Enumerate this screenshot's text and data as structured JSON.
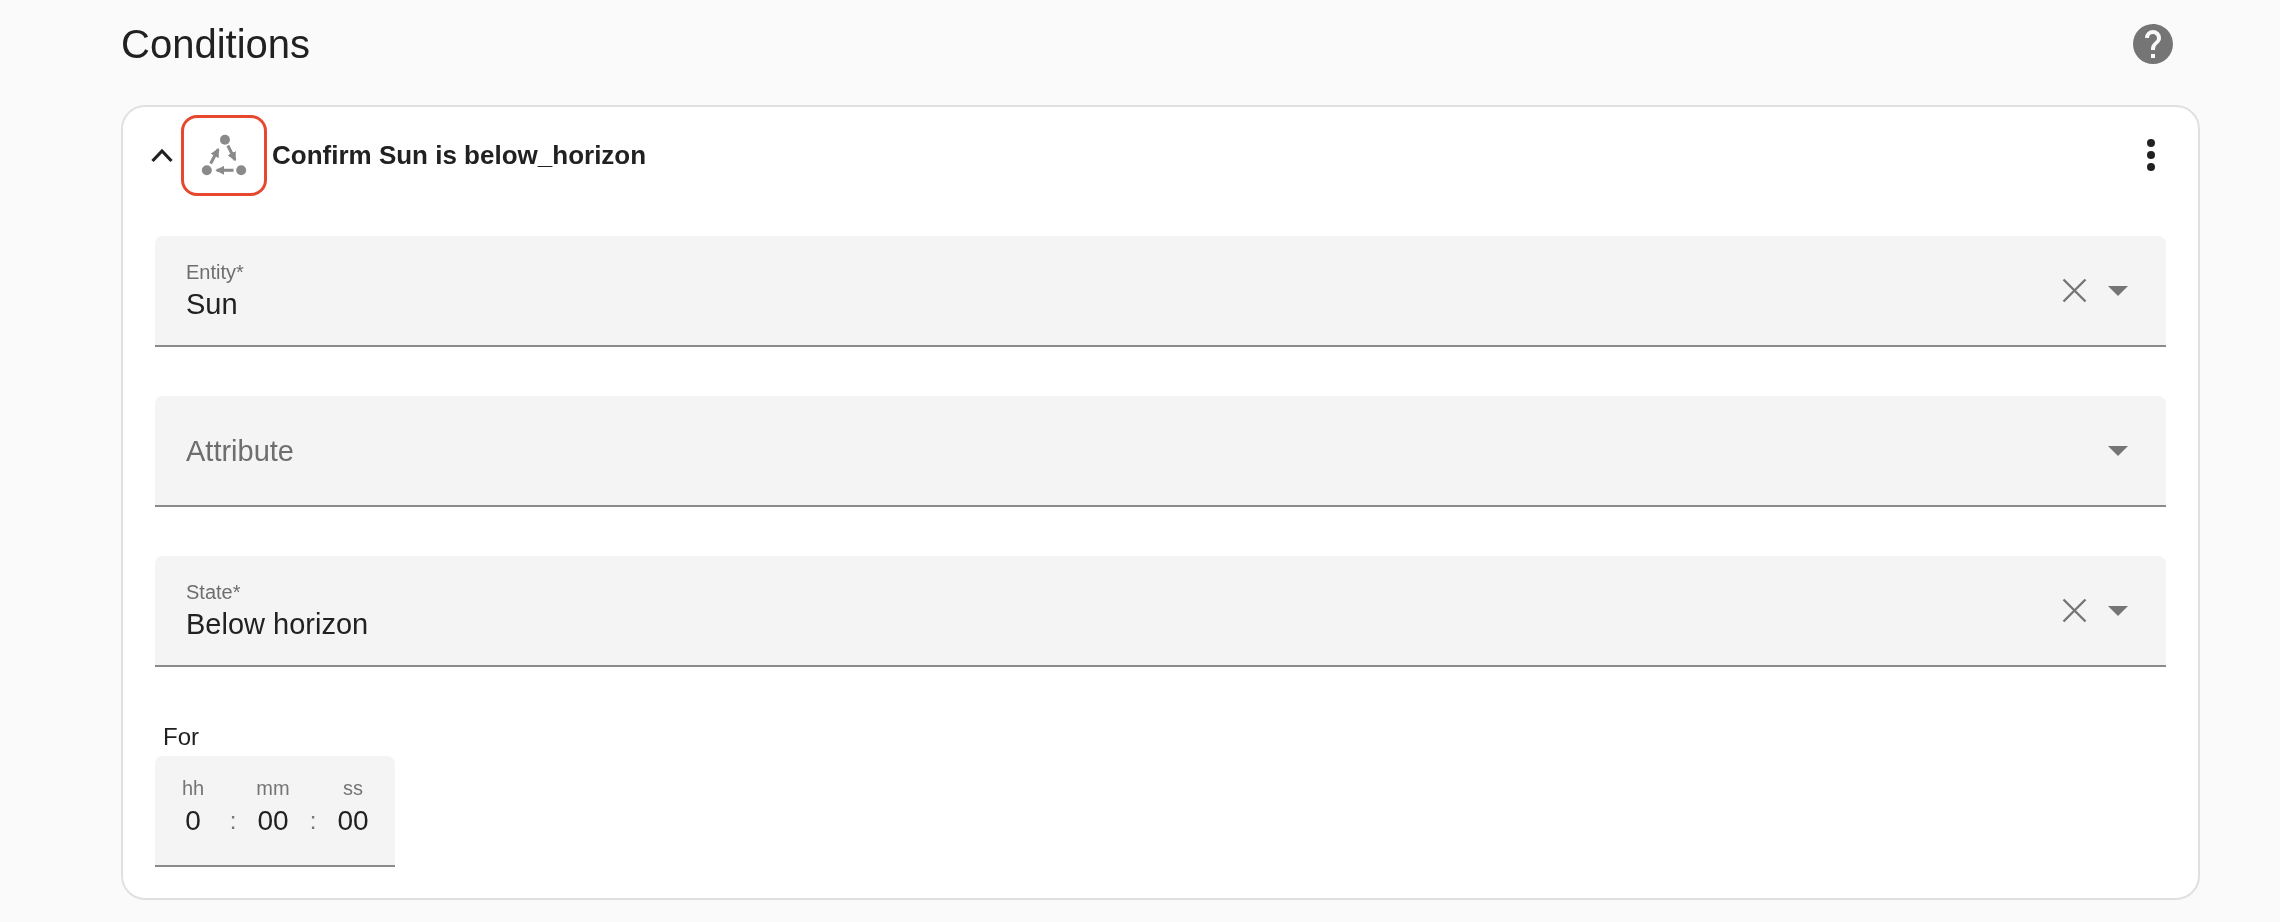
{
  "page": {
    "title": "Conditions"
  },
  "condition": {
    "title": "Confirm Sun is below_horizon",
    "expanded": true,
    "icon_highlighted": true,
    "fields": [
      {
        "kind": "select",
        "label": "Entity*",
        "value": "Sun"
      },
      {
        "kind": "select",
        "label": "Attribute"
      },
      {
        "kind": "select",
        "label": "State*",
        "value": "Below horizon"
      },
      {
        "kind": "duration",
        "label": "For",
        "units": [
          {
            "label": "hh",
            "value": "0"
          },
          {
            "label": "mm",
            "value": "00"
          },
          {
            "label": "ss",
            "value": "00"
          }
        ],
        "separators": [
          ":",
          ":"
        ]
      }
    ]
  }
}
